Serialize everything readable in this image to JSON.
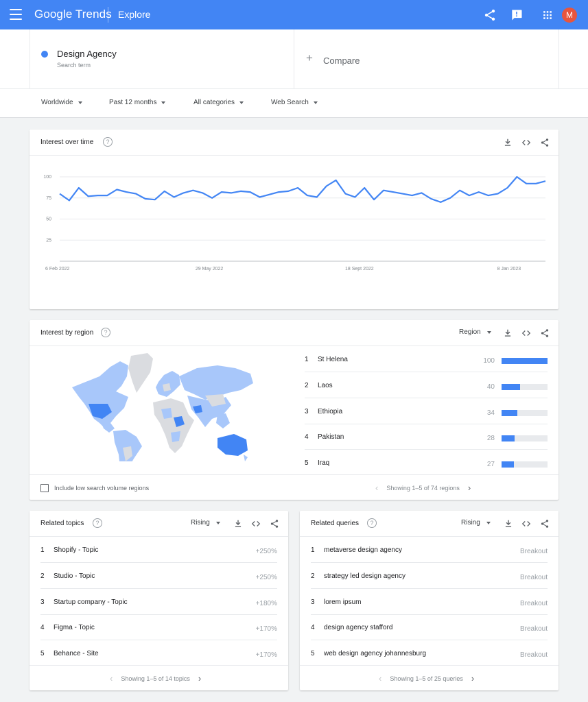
{
  "header": {
    "logo": "Google Trends",
    "section": "Explore",
    "avatar_letter": "M",
    "icons": [
      "menu-icon",
      "share-icon",
      "feedback-icon",
      "apps-icon"
    ]
  },
  "search": {
    "term": "Design Agency",
    "term_type": "Search term",
    "compare_label": "Compare",
    "term_color": "#4285f4"
  },
  "filters": {
    "region": "Worldwide",
    "period": "Past 12 months",
    "category": "All categories",
    "search_type": "Web Search"
  },
  "interest_over_time": {
    "title": "Interest over time",
    "chart_data": {
      "type": "line",
      "y_ticks": [
        "100",
        "75",
        "50",
        "25"
      ],
      "ylim": [
        0,
        100
      ],
      "x_ticks": [
        "6 Feb 2022",
        "29 May 2022",
        "18 Sept 2022",
        "8 Jan 2023"
      ],
      "series": [
        {
          "color": "#4285f4",
          "values": [
            80,
            72,
            87,
            77,
            78,
            78,
            85,
            82,
            80,
            74,
            73,
            83,
            76,
            81,
            84,
            81,
            75,
            82,
            81,
            83,
            82,
            76,
            79,
            82,
            83,
            87,
            78,
            76,
            89,
            96,
            80,
            76,
            87,
            73,
            84,
            82,
            80,
            78,
            81,
            74,
            70,
            75,
            84,
            78,
            82,
            78,
            80,
            87,
            100,
            92,
            92,
            95
          ]
        }
      ]
    }
  },
  "interest_by_region": {
    "title": "Interest by region",
    "dropdown": "Region",
    "rows": [
      {
        "rank": "1",
        "label": "St Helena",
        "value": "100",
        "pct": 100
      },
      {
        "rank": "2",
        "label": "Laos",
        "value": "40",
        "pct": 40
      },
      {
        "rank": "3",
        "label": "Ethiopia",
        "value": "34",
        "pct": 34
      },
      {
        "rank": "4",
        "label": "Pakistan",
        "value": "28",
        "pct": 28
      },
      {
        "rank": "5",
        "label": "Iraq",
        "value": "27",
        "pct": 27
      }
    ],
    "checkbox_label": "Include low search volume regions",
    "pager": "Showing 1–5 of 74 regions"
  },
  "related_topics": {
    "title": "Related topics",
    "dropdown": "Rising",
    "rows": [
      {
        "rank": "1",
        "label": "Shopify - Topic",
        "value": "+250%"
      },
      {
        "rank": "2",
        "label": "Studio - Topic",
        "value": "+250%"
      },
      {
        "rank": "3",
        "label": "Startup company - Topic",
        "value": "+180%"
      },
      {
        "rank": "4",
        "label": "Figma - Topic",
        "value": "+170%"
      },
      {
        "rank": "5",
        "label": "Behance - Site",
        "value": "+170%"
      }
    ],
    "pager": "Showing 1–5 of 14 topics"
  },
  "related_queries": {
    "title": "Related queries",
    "dropdown": "Rising",
    "rows": [
      {
        "rank": "1",
        "label": "metaverse design agency",
        "value": "Breakout"
      },
      {
        "rank": "2",
        "label": "strategy led design agency",
        "value": "Breakout"
      },
      {
        "rank": "3",
        "label": "lorem ipsum",
        "value": "Breakout"
      },
      {
        "rank": "4",
        "label": "design agency stafford",
        "value": "Breakout"
      },
      {
        "rank": "5",
        "label": "web design agency johannesburg",
        "value": "Breakout"
      }
    ],
    "pager": "Showing 1–5 of 25 queries"
  }
}
